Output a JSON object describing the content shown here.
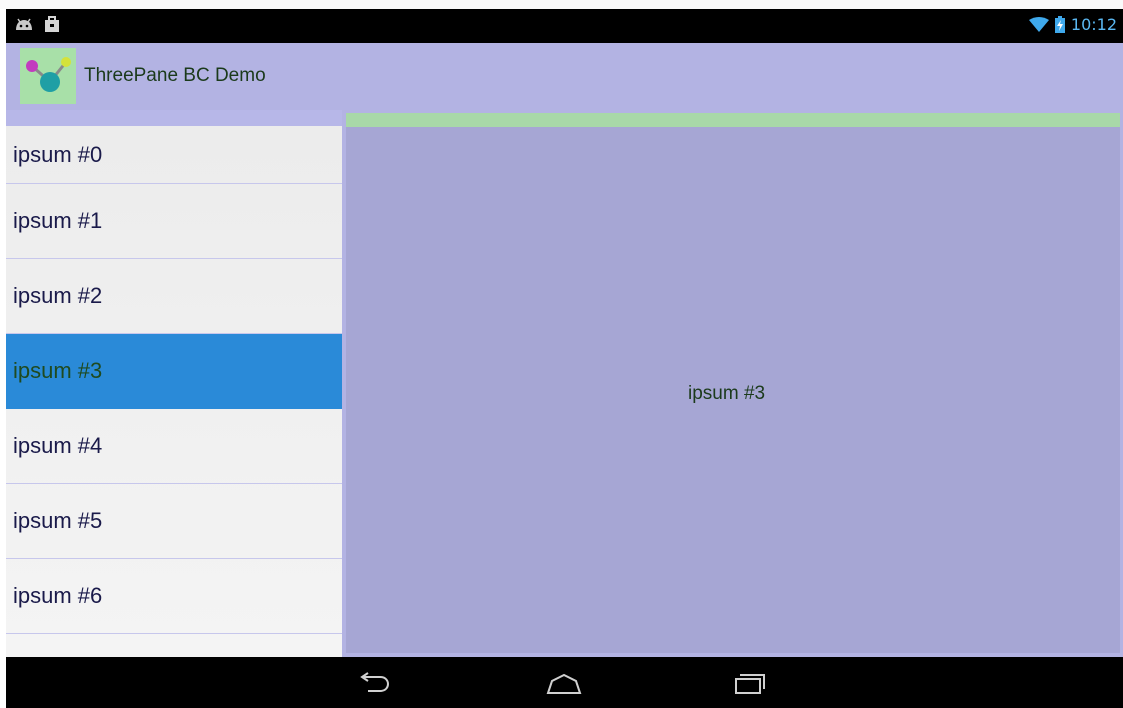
{
  "status_bar": {
    "time": "10:12",
    "icons": [
      "android-debug-icon",
      "shopping-bag-icon",
      "wifi-icon",
      "battery-charging-icon"
    ]
  },
  "action_bar": {
    "app_title": "ThreePane BC Demo",
    "icon": "molecule-icon"
  },
  "list": {
    "items": [
      "ipsum #0",
      "ipsum #1",
      "ipsum #2",
      "ipsum #3",
      "ipsum #4",
      "ipsum #5",
      "ipsum #6"
    ],
    "selected_index": 3
  },
  "detail": {
    "text": "ipsum #3"
  },
  "nav_bar": {
    "buttons": [
      "back-icon",
      "home-icon",
      "recents-icon"
    ]
  },
  "colors": {
    "action_bar": "#b3b3e3",
    "selected_item": "#2a8ad8",
    "detail_background": "#a6a6d4",
    "highlight_green": "#a8e0a8"
  }
}
